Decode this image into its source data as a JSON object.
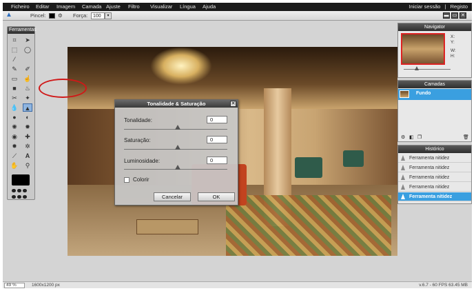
{
  "menu": [
    "Ficheiro",
    "Editar",
    "Imagem",
    "Camada",
    "Ajuste",
    "Filtro",
    "Visualizar",
    "Língua",
    "Ajuda"
  ],
  "account": {
    "login": "Iniciar sessão",
    "separator": "|",
    "register": "Registo"
  },
  "options_bar": {
    "brush_label": "Pincel:",
    "strength_label": "Força:",
    "strength_value": "100",
    "dropdown_glyph": "▾"
  },
  "window_buttons": [
    "▬",
    "▭",
    "✕"
  ],
  "tools_panel": {
    "title": "Ferramentas"
  },
  "dialog": {
    "title": "Tonalidade & Saturação",
    "close": "✕",
    "hue_label": "Tonalidade:",
    "hue_value": "0",
    "saturation_label": "Saturação:",
    "saturation_value": "0",
    "lightness_label": "Luminosidade:",
    "lightness_value": "0",
    "colorize_label": "Colorir",
    "cancel": "Cancelar",
    "ok": "OK"
  },
  "navigator": {
    "title": "Navigator",
    "x_label": "X:",
    "y_label": "Y:",
    "w_label": "W:",
    "h_label": "H:"
  },
  "layers": {
    "title": "Camadas",
    "layer_name": "Fundo"
  },
  "history": {
    "title": "Histórico",
    "items": [
      "Ferramenta nitidez",
      "Ferramenta nitidez",
      "Ferramenta nitidez",
      "Ferramenta nitidez",
      "Ferramenta nitidez"
    ]
  },
  "status": {
    "zoom": "49",
    "zoom_unit": "%",
    "dimensions": "1600x1200 px",
    "version": "v.6.7 - 60 FPS 63.45 MB"
  },
  "colors": {
    "accent": "#3a9fe0",
    "menubar": "#1b1b1b",
    "annotation": "#d01818"
  }
}
